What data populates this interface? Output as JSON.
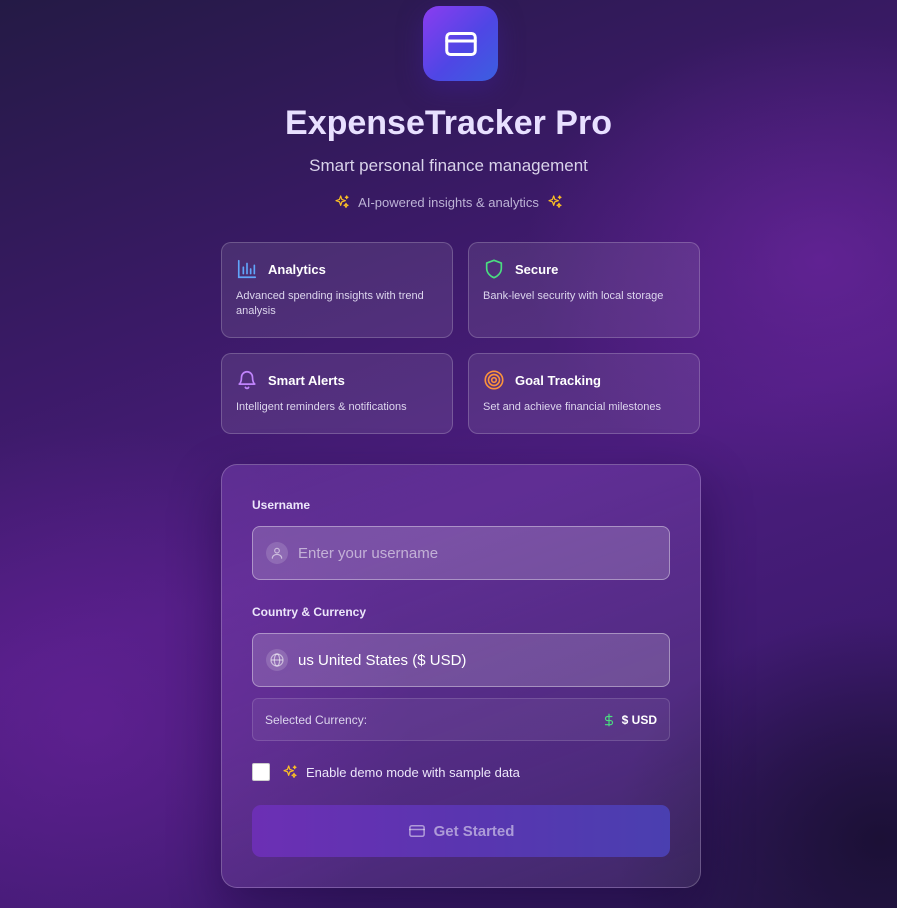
{
  "app": {
    "logo_icon": "credit-card-icon",
    "title": "ExpenseTracker Pro",
    "subtitle": "Smart personal finance management",
    "tagline": "AI-powered insights & analytics"
  },
  "features": [
    {
      "icon": "bar-chart-icon",
      "title": "Analytics",
      "description": "Advanced spending insights with trend analysis",
      "icon_color": "#60a5fa"
    },
    {
      "icon": "shield-icon",
      "title": "Secure",
      "description": "Bank-level security with local storage",
      "icon_color": "#4ade80"
    },
    {
      "icon": "bell-icon",
      "title": "Smart Alerts",
      "description": "Intelligent reminders & notifications",
      "icon_color": "#c084fc"
    },
    {
      "icon": "target-icon",
      "title": "Goal Tracking",
      "description": "Set and achieve financial milestones",
      "icon_color": "#fb923c"
    }
  ],
  "form": {
    "username_label": "Username",
    "username_placeholder": "Enter your username",
    "username_value": "",
    "country_label": "Country & Currency",
    "country_selected": "us United States ($ USD)",
    "selected_currency_label": "Selected Currency:",
    "selected_currency_value": "$ USD",
    "demo_mode_label": "Enable demo mode with sample data",
    "demo_mode_checked": false,
    "submit_label": "Get Started"
  },
  "colors": {
    "accent_purple": "#7c3aed",
    "accent_indigo": "#4f46e5",
    "sparkle": "#fbbf24",
    "currency_green": "#4ade80"
  }
}
